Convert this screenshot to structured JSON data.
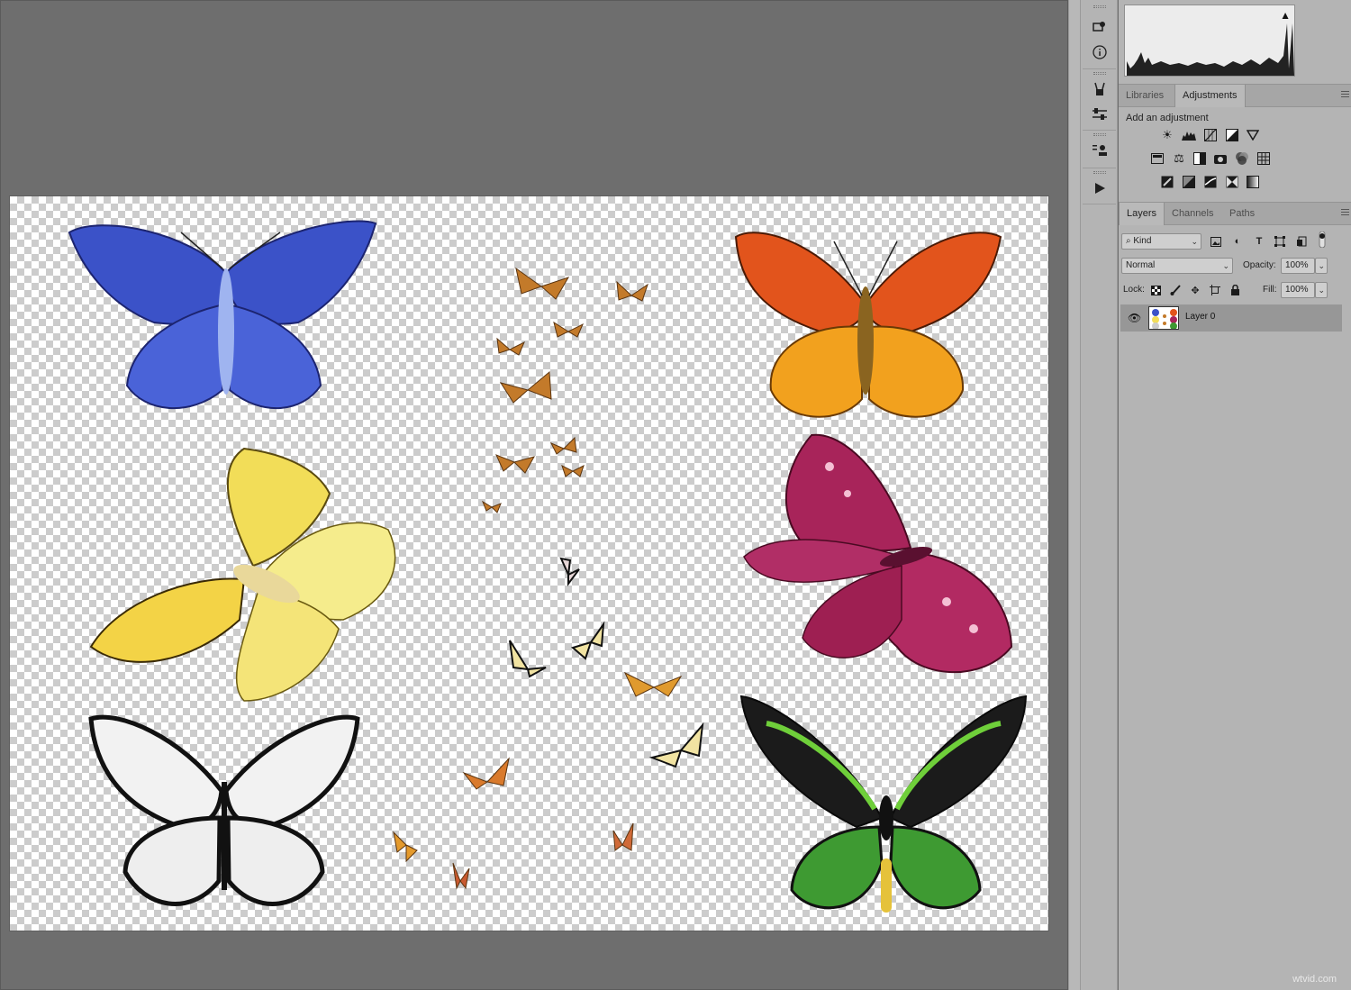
{
  "histogram": {
    "warning_icon": "warning-triangle-icon"
  },
  "adjustments_panel": {
    "tabs": [
      "Libraries",
      "Adjustments"
    ],
    "active_tab": "Adjustments",
    "heading": "Add an adjustment",
    "icon_rows": [
      [
        "brightness-contrast-icon",
        "levels-icon",
        "curves-icon",
        "exposure-icon",
        "vibrance-icon"
      ],
      [
        "hue-saturation-icon",
        "color-balance-icon",
        "black-white-icon",
        "photo-filter-icon",
        "channel-mixer-icon",
        "color-lookup-icon"
      ],
      [
        "invert-icon",
        "posterize-icon",
        "threshold-icon",
        "selective-color-icon",
        "gradient-map-icon"
      ]
    ]
  },
  "layers_panel": {
    "tabs": [
      "Layers",
      "Channels",
      "Paths"
    ],
    "active_tab": "Layers",
    "filter_kind": "Kind",
    "blend_mode": "Normal",
    "opacity_label": "Opacity:",
    "opacity_value": "100%",
    "lock_label": "Lock:",
    "fill_label": "Fill:",
    "fill_value": "100%",
    "layers": [
      {
        "name": "Layer 0",
        "visible": true,
        "selected": true
      }
    ]
  },
  "watermark": "wtvid.com",
  "colors": {
    "workspace": "#6e6e6e",
    "panel": "#b4b4b4",
    "selected_layer": "#979797"
  }
}
